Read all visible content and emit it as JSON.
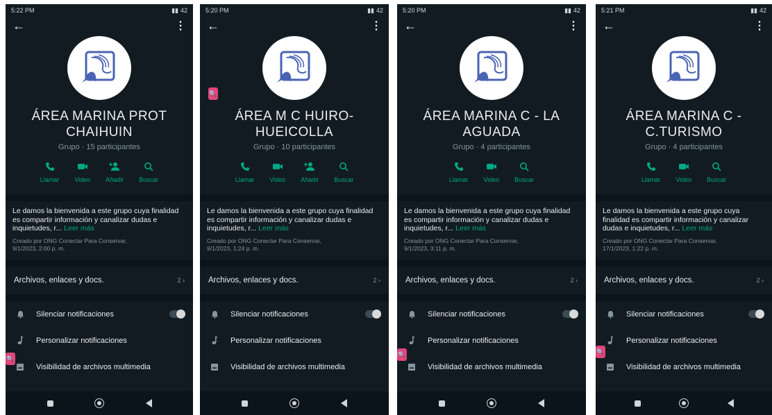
{
  "phones": [
    {
      "status_time": "5:22 PM",
      "status_right": "42",
      "title": "ÁREA MARINA PROT CHAIHUIN",
      "subtitle": "Grupo · 15 participantes",
      "actions": [
        "Llamar",
        "Video",
        "Añadir",
        "Buscar"
      ],
      "description": "Le damos la bienvenida a este grupo cuya finalidad es compartir información y canalizar dudas e inquietudes, r...",
      "read_more": "Leer más",
      "created_by": "Creado por ONG Conectar Para Conservar,",
      "created_date": "9/1/2023, 2:00 p. m.",
      "files_label": "Archivos, enlaces y docs.",
      "files_count": "2 ›",
      "settings": [
        "Silenciar notificaciones",
        "Personalizar notificaciones",
        "Visibilidad de archivos multimedia"
      ]
    },
    {
      "status_time": "5:20 PM",
      "status_right": "42",
      "title": "ÁREA M C HUIRO-HUEICOLLA",
      "subtitle": "Grupo · 10 participantes",
      "actions": [
        "Llamar",
        "Video",
        "Añadir",
        "Buscar"
      ],
      "description": "Le damos la bienvenida a este grupo cuya finalidad es compartir información y canalizar dudas e inquietudes, r...",
      "read_more": "Leer más",
      "created_by": "Creado por ONG Conectar Para Conservar,",
      "created_date": "9/1/2023, 1:24 p. m.",
      "files_label": "Archivos, enlaces y docs.",
      "files_count": "2 ›",
      "settings": [
        "Silenciar notificaciones",
        "Personalizar notificaciones",
        "Visibilidad de archivos multimedia"
      ]
    },
    {
      "status_time": "5:20 PM",
      "status_right": "42",
      "title": "ÁREA MARINA C - LA AGUADA",
      "subtitle": "Grupo · 4 participantes",
      "actions": [
        "Llamar",
        "Video",
        "Buscar"
      ],
      "description": "Le damos la bienvenida a este grupo cuya finalidad es compartir información y canalizar dudas e inquietudes, r...",
      "read_more": "Leer más",
      "created_by": "Creado por ONG Conectar Para Conservar,",
      "created_date": "9/1/2023, 3:11 p. m.",
      "files_label": "Archivos, enlaces y docs.",
      "files_count": "2 ›",
      "settings": [
        "Silenciar notificaciones",
        "Personalizar notificaciones",
        "Visibilidad de archivos multimedia"
      ]
    },
    {
      "status_time": "5:21 PM",
      "status_right": "42",
      "title": "ÁREA MARINA C - C.TURISMO",
      "subtitle": "Grupo · 4 participantes",
      "actions": [
        "Llamar",
        "Video",
        "Buscar"
      ],
      "description": "Le damos la bienvenida a este grupo cuya finalidad es compartir información y canalizar dudas e inquietudes, r...",
      "read_more": "Leer más",
      "created_by": "Creado por ONG Conectar Para Conservar,",
      "created_date": "17/1/2023, 1:22 p. m.",
      "files_label": "Archivos, enlaces y docs.",
      "files_count": "2 ›",
      "settings": [
        "Silenciar notificaciones",
        "Personalizar notificaciones",
        "Visibilidad de archivos multimedia"
      ]
    }
  ],
  "colors": {
    "accent": "#00a884",
    "background": "#121b22",
    "pink": "#e0457b"
  }
}
